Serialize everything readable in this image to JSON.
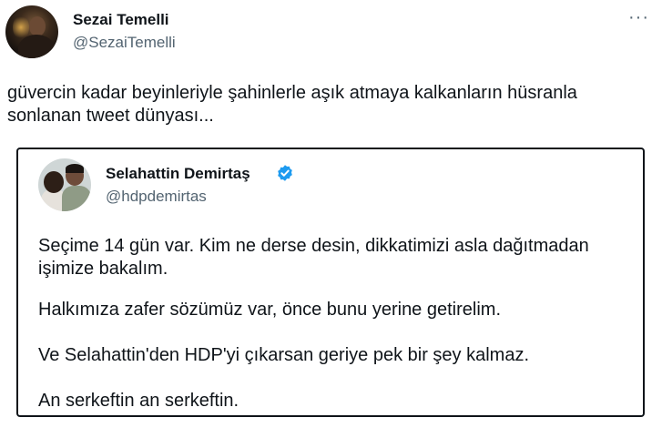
{
  "tweet": {
    "author": {
      "name": "Sezai Temelli",
      "handle": "@SezaiTemelli"
    },
    "more_icon": "ellipsis-icon",
    "text": "güvercin kadar beyinleriyle şahinlerle aşık atmaya kalkanların hüsranla sonlanan tweet dünyası..."
  },
  "quoted_tweet": {
    "author": {
      "name": "Selahattin Demirtaş",
      "handle": "@hdpdemirtas",
      "verified_icon": "verified-badge-icon",
      "verified_color": "#1d9bf0"
    },
    "paragraphs": [
      "Seçime 14 gün var. Kim ne derse desin, dikkatimizi asla dağıtmadan işimize bakalım.",
      "Halkımıza zafer sözümüz var, önce bunu yerine getirelim.",
      "Ve Selahattin'den HDP'yi çıkarsan geriye pek bir şey kalmaz.",
      "An serkeftin an serkeftin."
    ]
  }
}
